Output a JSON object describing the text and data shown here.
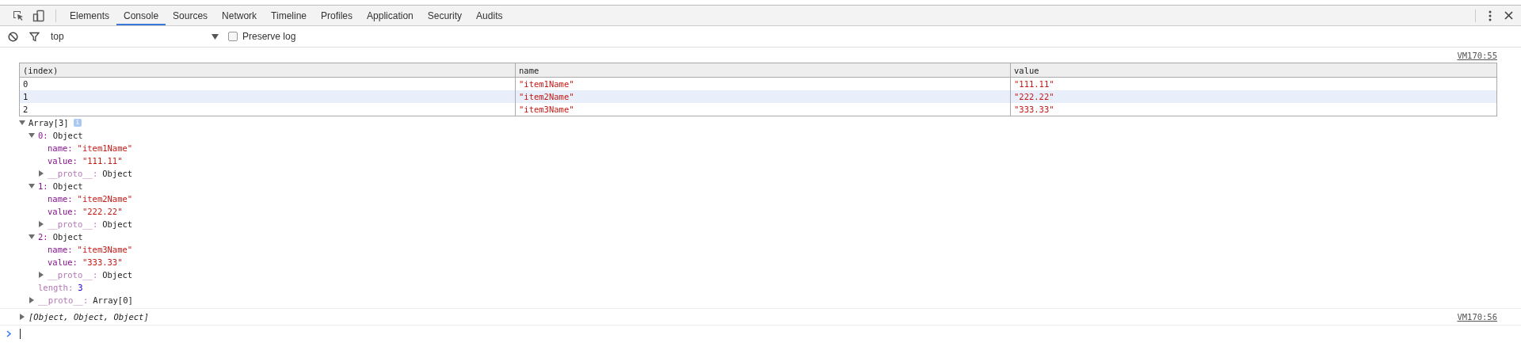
{
  "toolbar": {
    "tabs": [
      {
        "label": "Elements",
        "selected": false
      },
      {
        "label": "Console",
        "selected": true
      },
      {
        "label": "Sources",
        "selected": false
      },
      {
        "label": "Network",
        "selected": false
      },
      {
        "label": "Timeline",
        "selected": false
      },
      {
        "label": "Profiles",
        "selected": false
      },
      {
        "label": "Application",
        "selected": false
      },
      {
        "label": "Security",
        "selected": false
      },
      {
        "label": "Audits",
        "selected": false
      }
    ]
  },
  "filter_bar": {
    "context": "top",
    "preserve_log": {
      "label": "Preserve log",
      "checked": false
    }
  },
  "messages": [
    {
      "source": "VM170:55",
      "table": {
        "columns": [
          "(index)",
          "name",
          "value"
        ],
        "rows": [
          {
            "cells": [
              "0",
              "\"item1Name\"",
              "\"111.11\""
            ],
            "selected": false
          },
          {
            "cells": [
              "1",
              "\"item2Name\"",
              "\"222.22\""
            ],
            "selected": true
          },
          {
            "cells": [
              "2",
              "\"item3Name\"",
              "\"333.33\""
            ],
            "selected": false
          }
        ]
      },
      "tree": {
        "label": "Array[3]",
        "badge": "i",
        "expanded": true,
        "children": [
          {
            "key": "0:",
            "kind": "index",
            "value": "Object",
            "color": "#222222",
            "expanded": true,
            "children": [
              {
                "key": "name:",
                "kind": "property",
                "value": "\"item1Name\"",
                "color": "#c41a16"
              },
              {
                "key": "value:",
                "kind": "property",
                "value": "\"111.11\"",
                "color": "#c41a16"
              },
              {
                "key": "__proto__:",
                "kind": "internal",
                "value": "Object",
                "color": "#222222",
                "expanded": false
              }
            ]
          },
          {
            "key": "1:",
            "kind": "index",
            "value": "Object",
            "color": "#222222",
            "expanded": true,
            "children": [
              {
                "key": "name:",
                "kind": "property",
                "value": "\"item2Name\"",
                "color": "#c41a16"
              },
              {
                "key": "value:",
                "kind": "property",
                "value": "\"222.22\"",
                "color": "#c41a16"
              },
              {
                "key": "__proto__:",
                "kind": "internal",
                "value": "Object",
                "color": "#222222",
                "expanded": false
              }
            ]
          },
          {
            "key": "2:",
            "kind": "index",
            "value": "Object",
            "color": "#222222",
            "expanded": true,
            "children": [
              {
                "key": "name:",
                "kind": "property",
                "value": "\"item3Name\"",
                "color": "#c41a16"
              },
              {
                "key": "value:",
                "kind": "property",
                "value": "\"333.33\"",
                "color": "#c41a16"
              },
              {
                "key": "__proto__:",
                "kind": "internal",
                "value": "Object",
                "color": "#222222",
                "expanded": false
              }
            ]
          },
          {
            "key": "length:",
            "kind": "internal",
            "value": "3",
            "color": "#1c00cf"
          },
          {
            "key": "__proto__:",
            "kind": "internal",
            "value": "Array[0]",
            "color": "#222222",
            "expanded": false
          }
        ]
      }
    },
    {
      "source": "VM170:56",
      "summary": {
        "text": "[Object, Object, Object]",
        "expanded": false
      }
    }
  ]
}
